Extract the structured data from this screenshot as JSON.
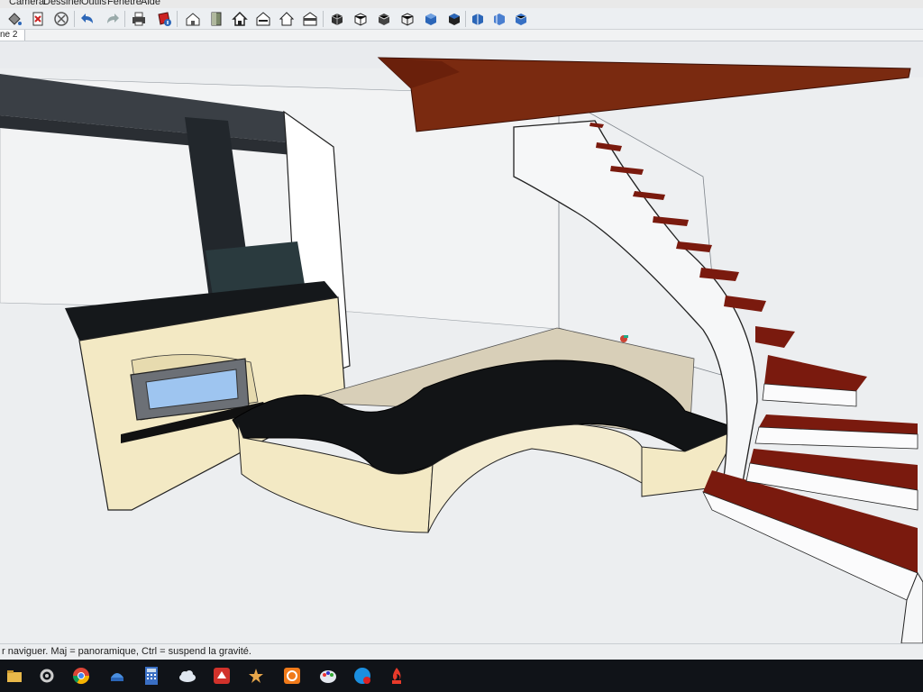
{
  "menubar": {
    "items": [
      "Caméra",
      "Dessiner",
      "Outils",
      "Fenêtre",
      "Aide"
    ]
  },
  "toolbar": {
    "buttons": [
      "paint-bucket-icon",
      "delete-icon",
      "cancel-icon",
      "undo-icon",
      "redo-icon",
      "print-icon",
      "model-info-icon",
      "iso-view-icon",
      "top-view-icon",
      "front-view-icon",
      "right-view-icon",
      "back-view-icon",
      "left-view-icon",
      "xray-icon",
      "back-edges-icon",
      "wireframe-icon",
      "hidden-line-icon",
      "shaded-icon",
      "shaded-textures-icon",
      "monochrome-icon",
      "section-plane-icon",
      "display-section-icon",
      "section-cuts-icon"
    ]
  },
  "scene_tab": {
    "label": "ne 2"
  },
  "status_bar": {
    "text": "r naviguer. Maj = panoramique, Ctrl =  suspend la gravité."
  },
  "taskbar": {
    "items": [
      "file-explorer-icon",
      "settings-icon",
      "chrome-icon",
      "network-icon",
      "calculator-icon",
      "cloud-icon",
      "sketchup-icon",
      "lightroom-icon",
      "avast-icon",
      "paint-icon",
      "skype-icon",
      "flame-app-icon"
    ]
  },
  "colors": {
    "viewport_bg": "#e9ebee",
    "stair_tread": "#7a1a0e",
    "stair_landing": "#7a2a10",
    "cream_wall": "#f3e9c4",
    "bench_top": "#101214",
    "floor": "#d8cfb8",
    "accent_blue": "#2b66b8"
  }
}
